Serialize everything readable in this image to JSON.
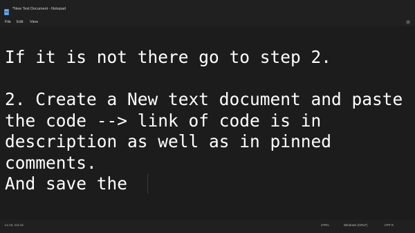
{
  "window": {
    "title": "*New Text Document - Notepad",
    "app_icon": "notepad-icon"
  },
  "menu": {
    "file": "File",
    "edit": "Edit",
    "view": "View",
    "settings_icon": "gear-icon"
  },
  "editor": {
    "lines": [
      "If it is not there go to step 2.",
      "",
      "2. Create a New text document and paste",
      "the code --> link of code is in",
      "description as well as in pinned",
      "comments.",
      "And save the "
    ]
  },
  "status": {
    "position": "Ln 13, Col 14",
    "zoom": "270%",
    "line_ending": "Windows (CRLF)",
    "encoding": "UTF-8"
  },
  "colors": {
    "background": "#1c1c1c",
    "chrome": "#202020",
    "text": "#ffffff"
  }
}
